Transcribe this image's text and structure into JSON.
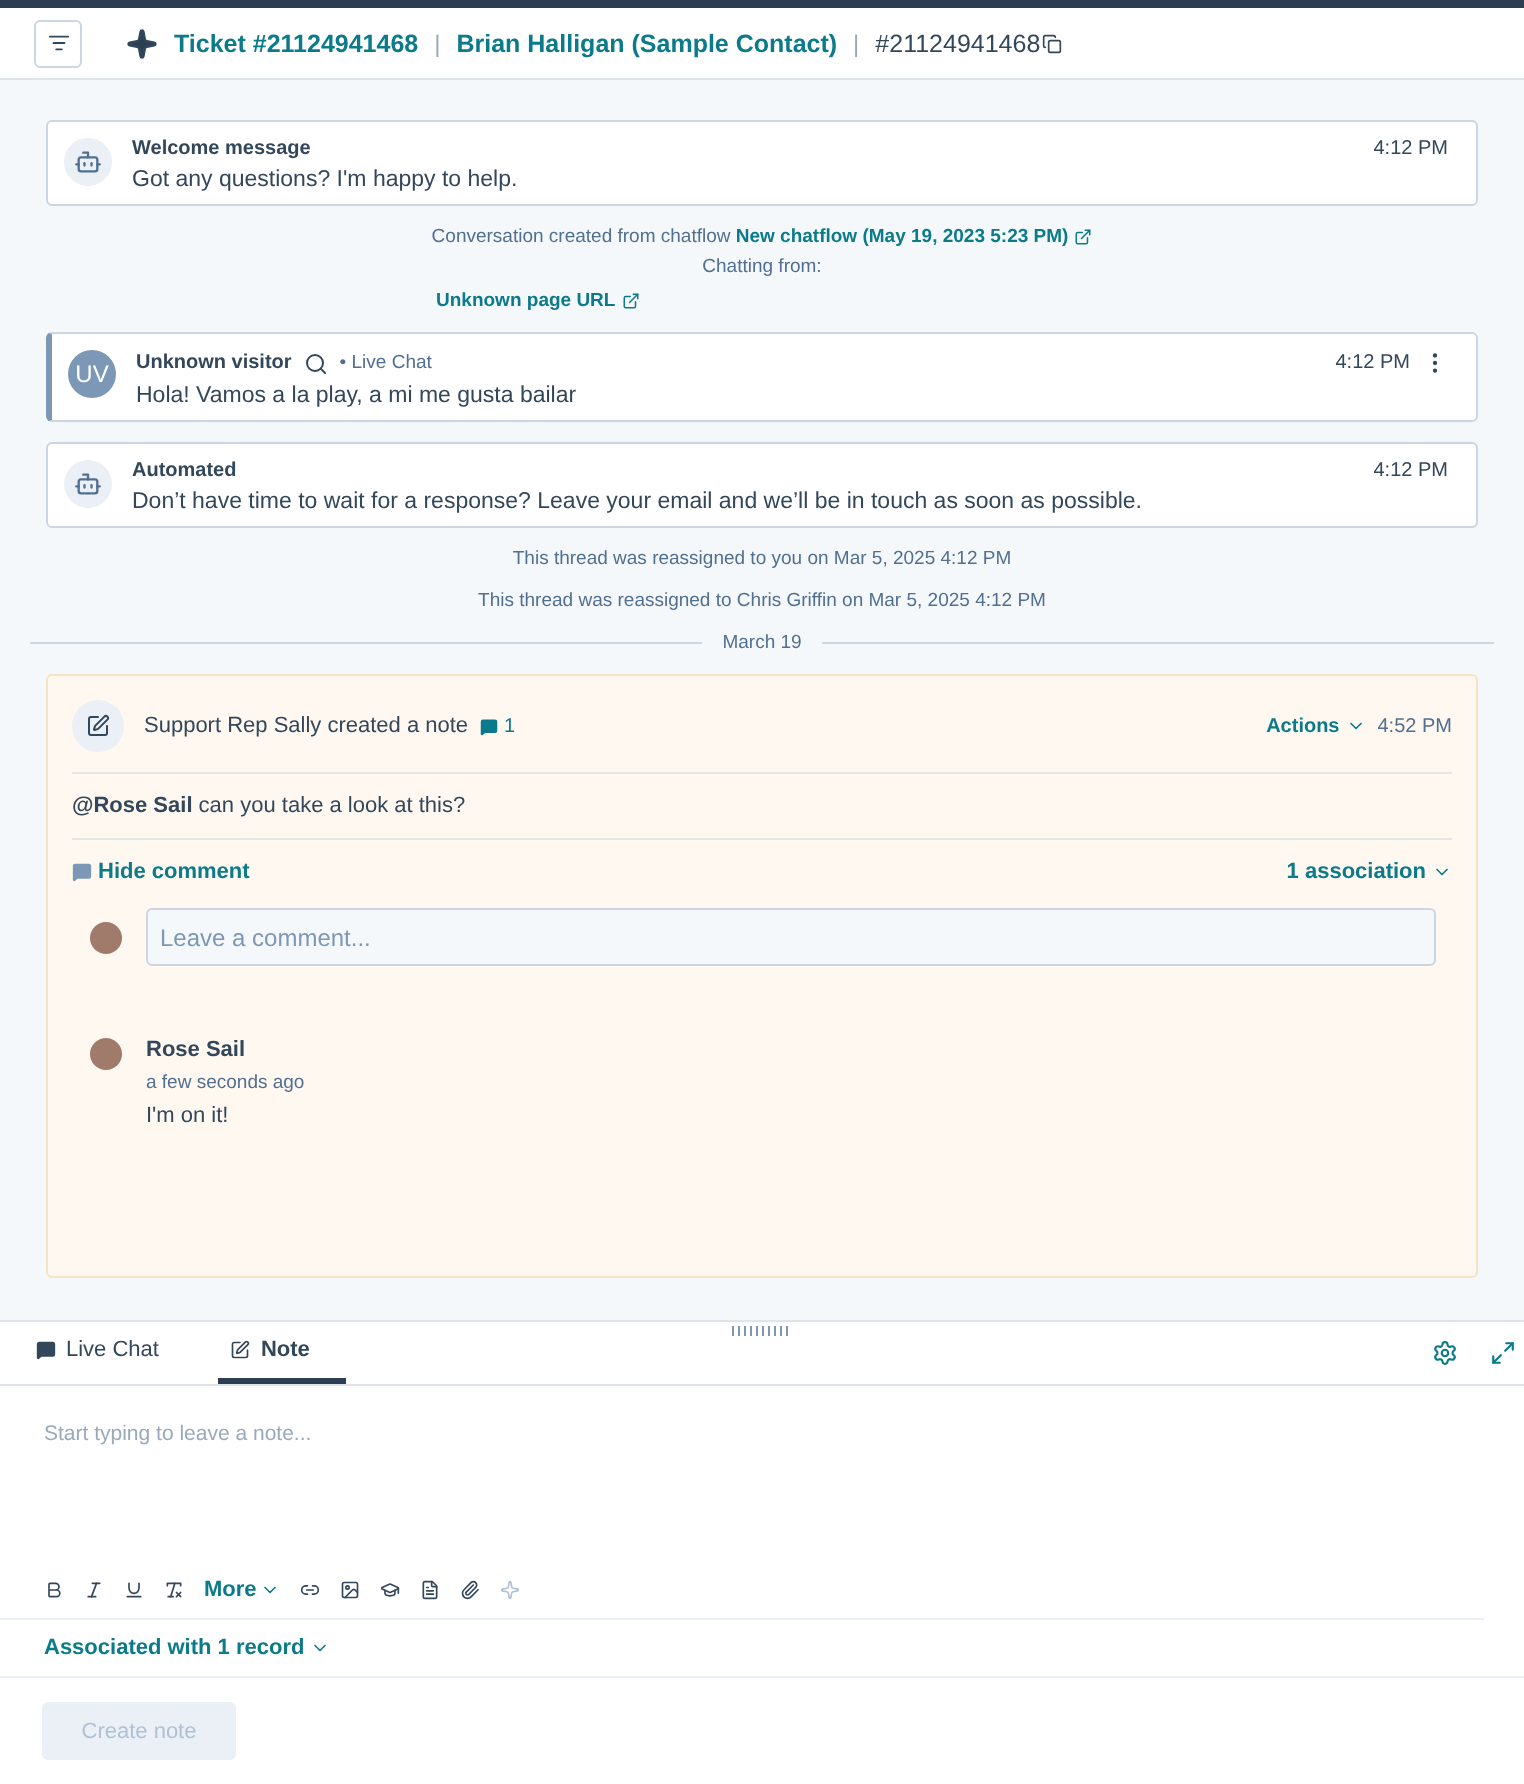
{
  "header": {
    "ticket": "Ticket #21124941468",
    "separator": "|",
    "contact": "Brian Halligan (Sample Contact)",
    "ticket_id": "#21124941468"
  },
  "messages": [
    {
      "kind": "bot",
      "sender": "Welcome message",
      "time": "4:12 PM",
      "text": "Got any questions? I'm happy to help."
    },
    {
      "kind": "chatflow",
      "prefix": "Conversation created from chatflow",
      "link": "New chatflow (May 19, 2023 5:23 PM)",
      "label": "Chatting from:",
      "url": "Unknown page URL"
    },
    {
      "kind": "visitor",
      "initials": "UV",
      "sender": "Unknown visitor",
      "channel": "• Live Chat",
      "time": "4:12 PM",
      "text": "Hola! Vamos a la play, a mi me gusta bailar"
    },
    {
      "kind": "bot",
      "sender": "Automated",
      "time": "4:12 PM",
      "text": "Don’t have time to wait for a response? Leave your email and we’ll be in touch as soon as possible."
    },
    {
      "kind": "system",
      "text": "This thread was reassigned to you on Mar 5, 2025 4:12 PM"
    },
    {
      "kind": "system",
      "text": "This thread was reassigned to Chris Griffin on Mar 5, 2025 4:12 PM"
    },
    {
      "kind": "date",
      "text": "March 19"
    }
  ],
  "note": {
    "title": "Support Rep Sally created a note",
    "comment_count": "1",
    "actions": "Actions",
    "time": "4:52 PM",
    "body": "**@Rose Sail** can you take a look at this?",
    "hide_comment": "Hide comment",
    "associations": "1 association",
    "comment_placeholder": "Leave a comment...",
    "comments": [
      {
        "author": "Rose Sail",
        "when": "a few seconds ago",
        "text": "I'm on it!"
      }
    ]
  },
  "composer": {
    "tabs": [
      {
        "label": "Live Chat",
        "selected": false
      },
      {
        "label": "Note",
        "selected": true
      }
    ],
    "placeholder": "Start typing to leave a note...",
    "more": "More",
    "associated": "Associated with 1 record",
    "submit": "Create note",
    "submit_disabled": true
  }
}
